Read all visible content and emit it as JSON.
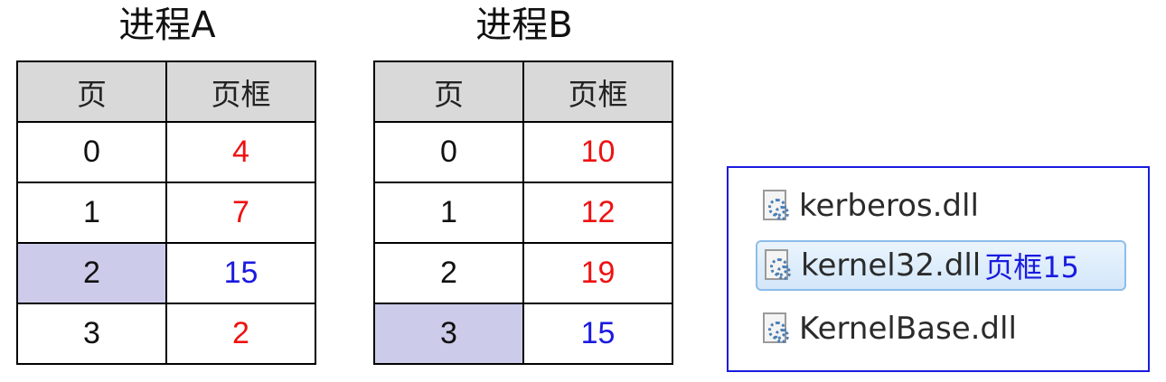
{
  "process_a": {
    "title": "进程A",
    "header": {
      "page": "页",
      "frame": "页框"
    },
    "rows": [
      {
        "page": "0",
        "frame": "4"
      },
      {
        "page": "1",
        "frame": "7"
      },
      {
        "page": "2",
        "frame": "15"
      },
      {
        "page": "3",
        "frame": "2"
      }
    ],
    "highlighted_page_index": 2
  },
  "process_b": {
    "title": "进程B",
    "header": {
      "page": "页",
      "frame": "页框"
    },
    "rows": [
      {
        "page": "0",
        "frame": "10"
      },
      {
        "page": "1",
        "frame": "12"
      },
      {
        "page": "2",
        "frame": "19"
      },
      {
        "page": "3",
        "frame": "15"
      }
    ],
    "highlighted_page_index": 3
  },
  "dll_list": {
    "items": [
      {
        "name": "kerberos.dll"
      },
      {
        "name": "kernel32.dll",
        "selected": true,
        "note": "页框15"
      },
      {
        "name": "KernelBase.dll"
      }
    ]
  },
  "colors": {
    "frame_text": "#ee1111",
    "shared_frame_text": "#1a1ae0",
    "header_bg": "#d9d9d9",
    "highlight_bg": "#ccccea",
    "panel_border": "#1a1ae0"
  }
}
